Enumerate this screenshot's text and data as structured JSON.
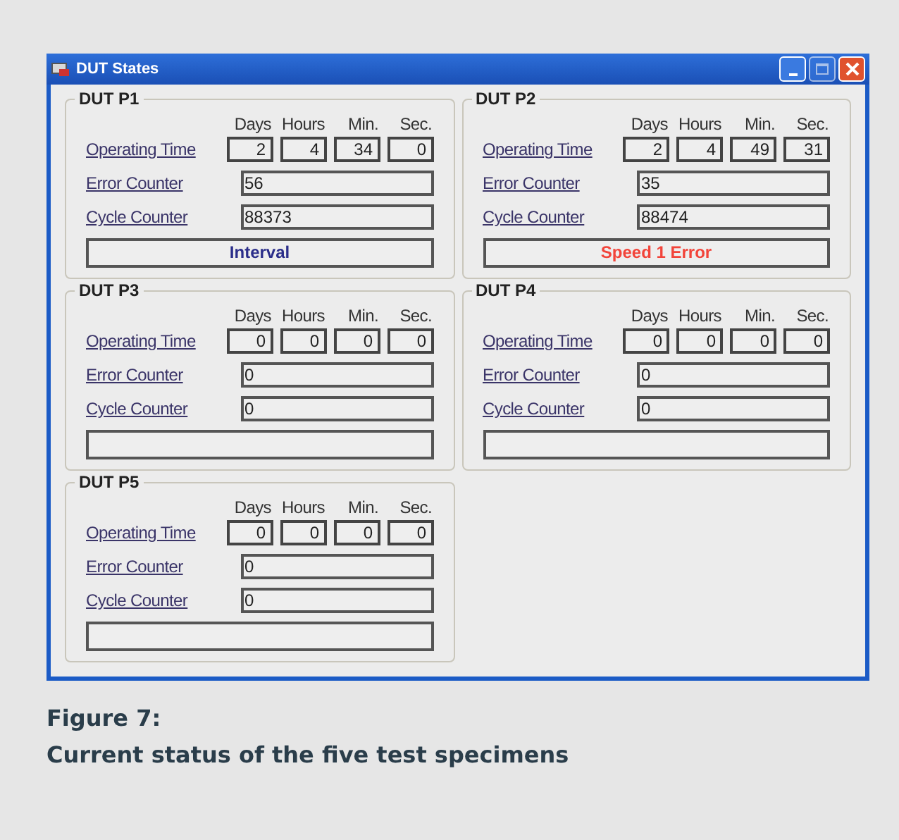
{
  "window": {
    "title": "DUT States"
  },
  "panels": [
    {
      "title": "DUT P1",
      "units": [
        "Days",
        "Hours",
        "Min.",
        "Sec."
      ],
      "labels": [
        "Operating Time",
        "Error Counter",
        "Cycle Counter"
      ],
      "time": [
        "2",
        "4",
        "34",
        "0"
      ],
      "error_counter": "56",
      "cycle_counter": "88373",
      "status": {
        "text": "Interval",
        "color": "#2b2e8a"
      }
    },
    {
      "title": "DUT P2",
      "units": [
        "Days",
        "Hours",
        "Min.",
        "Sec."
      ],
      "labels": [
        "Operating Time",
        "Error Counter",
        "Cycle Counter"
      ],
      "time": [
        "2",
        "4",
        "49",
        "31"
      ],
      "error_counter": "35",
      "cycle_counter": "88474",
      "status": {
        "text": "Speed 1 Error",
        "color": "#f2443a"
      }
    },
    {
      "title": "DUT P3",
      "units": [
        "Days",
        "Hours",
        "Min.",
        "Sec."
      ],
      "labels": [
        "Operating Time",
        "Error Counter",
        "Cycle Counter"
      ],
      "time": [
        "0",
        "0",
        "0",
        "0"
      ],
      "error_counter": "0",
      "cycle_counter": "0"
    },
    {
      "title": "DUT P4",
      "units": [
        "Days",
        "Hours",
        "Min.",
        "Sec."
      ],
      "labels": [
        "Operating Time",
        "Error Counter",
        "Cycle Counter"
      ],
      "time": [
        "0",
        "0",
        "0",
        "0"
      ],
      "error_counter": "0",
      "cycle_counter": "0"
    },
    {
      "title": "DUT P5",
      "units": [
        "Days",
        "Hours",
        "Min.",
        "Sec."
      ],
      "labels": [
        "Operating Time",
        "Error Counter",
        "Cycle Counter"
      ],
      "time": [
        "0",
        "0",
        "0",
        "0"
      ],
      "error_counter": "0",
      "cycle_counter": "0"
    }
  ],
  "caption": {
    "label": "Figure 7:",
    "text": "Current status of the five test specimens"
  }
}
